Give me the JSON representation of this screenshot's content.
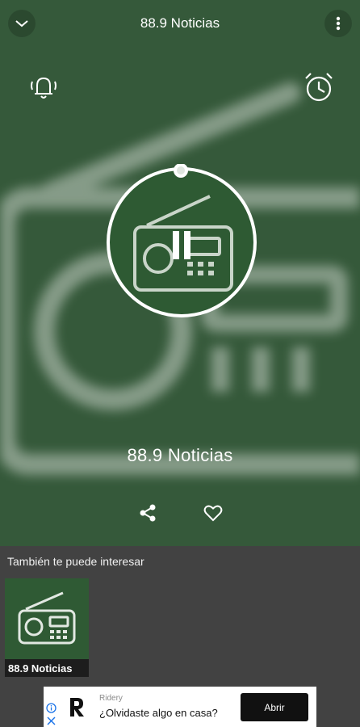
{
  "header": {
    "title": "88.9 Noticias"
  },
  "player": {
    "station_name": "88.9 Noticias"
  },
  "suggestions": {
    "title": "También te puede interesar",
    "items": [
      {
        "label": "88.9 Noticias"
      }
    ]
  },
  "ad": {
    "brand": "Ridery",
    "text": "¿Olvidaste algo en casa?",
    "button": "Abrir"
  },
  "colors": {
    "player_bg": "#35593a",
    "suggest_bg": "#424242",
    "card_bg": "#2f5a34"
  },
  "icons": [
    "chevron-down-icon",
    "more-vert-icon",
    "bell-icon",
    "alarm-clock-icon",
    "radio-icon",
    "share-icon",
    "heart-icon",
    "info-icon",
    "close-icon"
  ]
}
